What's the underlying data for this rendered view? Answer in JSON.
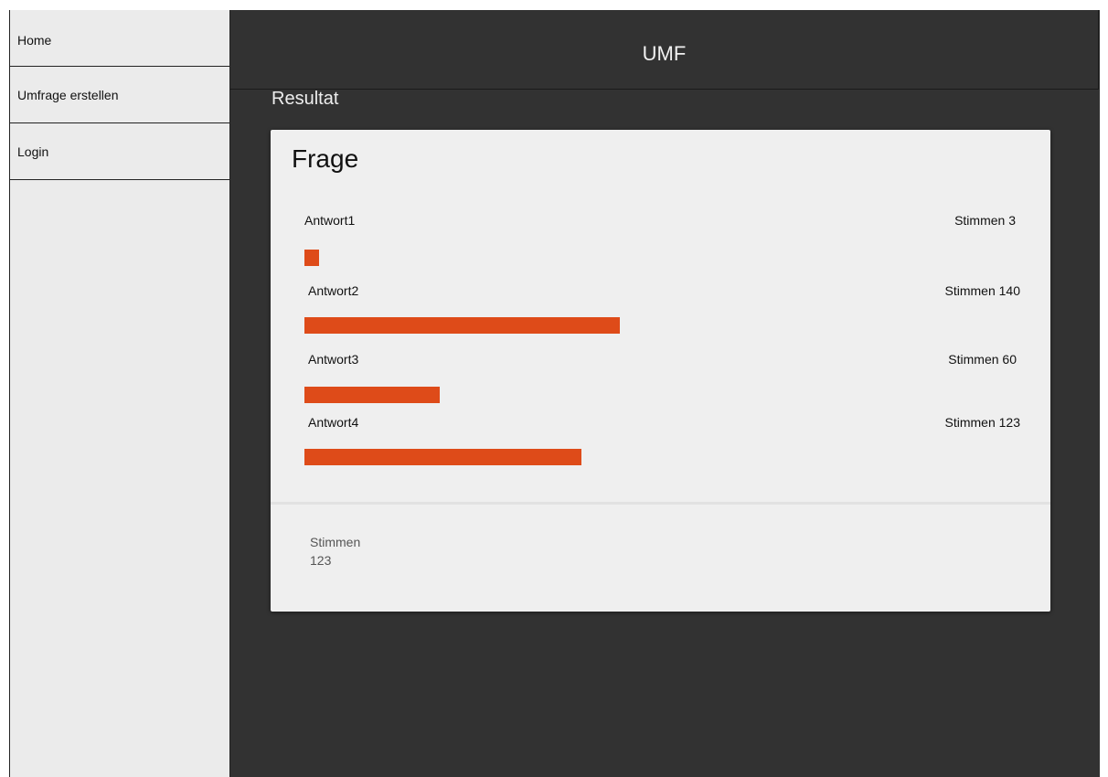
{
  "sidebar": {
    "items": [
      {
        "label": "Home"
      },
      {
        "label": "Umfrage erstellen"
      },
      {
        "label": "Login"
      }
    ]
  },
  "header": {
    "title": "UMF"
  },
  "main": {
    "section_title": "Resultat"
  },
  "card": {
    "question": "Frage",
    "answers": [
      {
        "label": "Antwort1",
        "votes_text": "Stimmen 3",
        "votes": 3
      },
      {
        "label": "Antwort2",
        "votes_text": "Stimmen 140",
        "votes": 140
      },
      {
        "label": "Antwort3",
        "votes_text": "Stimmen 60",
        "votes": 60
      },
      {
        "label": "Antwort4",
        "votes_text": "Stimmen 123",
        "votes": 123
      }
    ],
    "footer": {
      "label": "Stimmen",
      "value": "123"
    }
  },
  "colors": {
    "accent": "#de4b19",
    "background": "#323232",
    "sidebar": "#ebebeb",
    "card": "#efefef"
  }
}
